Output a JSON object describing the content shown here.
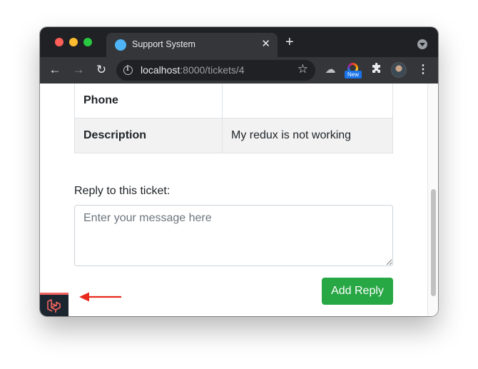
{
  "browser": {
    "tab_title": "Support System",
    "tab_close": "✕",
    "new_tab": "+",
    "url_host": "localhost",
    "url_rest": ":8000/tickets/4",
    "extension_badge": "New"
  },
  "ticket": {
    "rows": [
      {
        "label": "Phone",
        "value": ""
      },
      {
        "label": "Description",
        "value": "My redux is not working"
      }
    ]
  },
  "reply": {
    "label": "Reply to this ticket:",
    "placeholder": "Enter your message here",
    "submit_label": "Add Reply"
  },
  "colors": {
    "accent_green": "#28a745",
    "annotation_arrow": "#e8291c",
    "laravel_red": "#f4645f"
  }
}
